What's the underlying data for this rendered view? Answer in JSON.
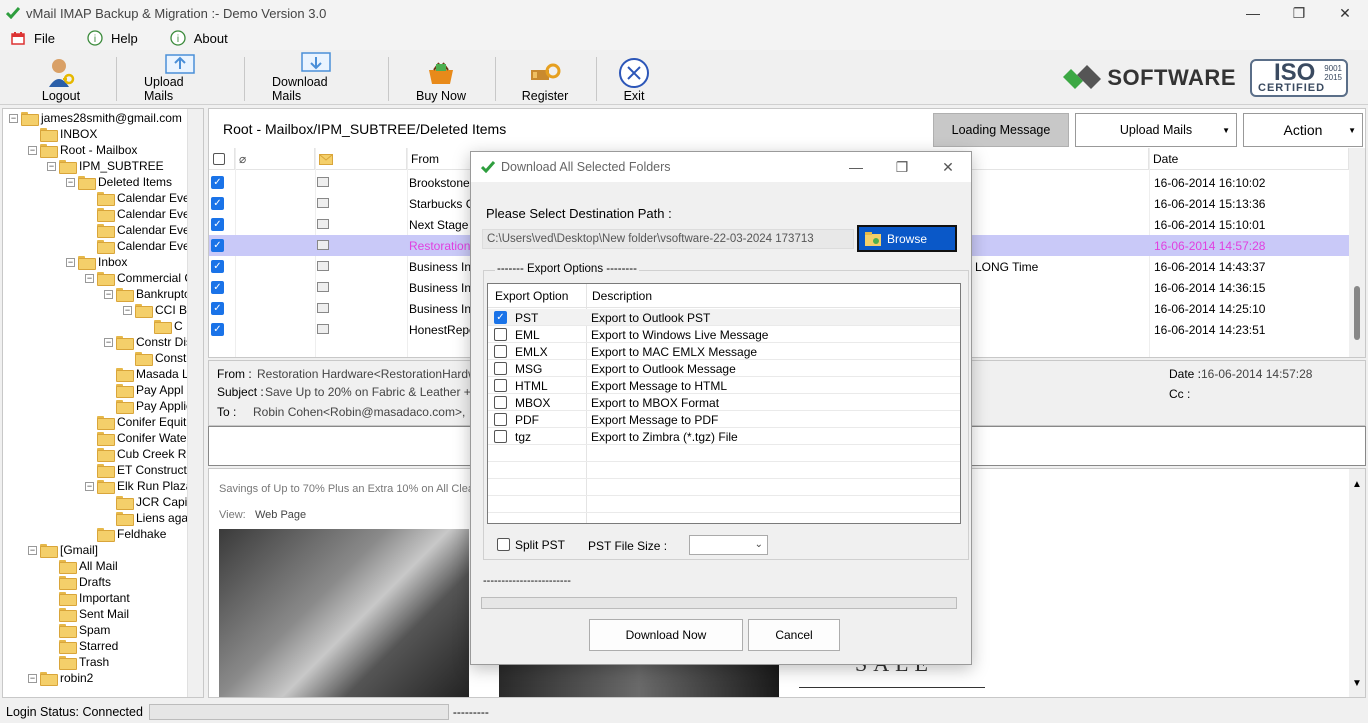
{
  "window": {
    "title": "vMail IMAP Backup & Migration :- Demo Version 3.0",
    "controls": {
      "minimize": "—",
      "maximize": "❐",
      "close": "✕"
    }
  },
  "menu": [
    {
      "label": "File",
      "icon": "file-menu-icon"
    },
    {
      "label": "Help",
      "icon": "help-icon"
    },
    {
      "label": "About",
      "icon": "info-icon"
    }
  ],
  "toolbar": {
    "logout": "Logout",
    "upload": "Upload Mails",
    "download": "Download Mails",
    "buy": "Buy Now",
    "register": "Register",
    "exit": "Exit"
  },
  "brand": {
    "name": "SOFTWARE",
    "iso": "ISO",
    "iso_numbers": "9001\n2015",
    "iso_certified": "CERTIFIED"
  },
  "tree": [
    {
      "label": "james28smith@gmail.com",
      "level": 0,
      "exp": "−"
    },
    {
      "label": "INBOX",
      "level": 1
    },
    {
      "label": "Root - Mailbox",
      "level": 1,
      "exp": "−"
    },
    {
      "label": "IPM_SUBTREE",
      "level": 2,
      "exp": "−"
    },
    {
      "label": "Deleted Items",
      "level": 3,
      "exp": "−"
    },
    {
      "label": "Calendar Ever",
      "level": 4
    },
    {
      "label": "Calendar Ever",
      "level": 4
    },
    {
      "label": "Calendar Ever",
      "level": 4
    },
    {
      "label": "Calendar Ever",
      "level": 4
    },
    {
      "label": "Inbox",
      "level": 3,
      "exp": "−"
    },
    {
      "label": "Commercial C",
      "level": 4,
      "exp": "−"
    },
    {
      "label": "Bankrupto",
      "level": 5,
      "exp": "−"
    },
    {
      "label": "CCI B",
      "level": 6,
      "exp": "−"
    },
    {
      "label": "C",
      "level": 7
    },
    {
      "label": "Constr Dis",
      "level": 5,
      "exp": "−"
    },
    {
      "label": "Const",
      "level": 6
    },
    {
      "label": "Masada L",
      "level": 5
    },
    {
      "label": "Pay Appl",
      "level": 5
    },
    {
      "label": "Pay Applic",
      "level": 5
    },
    {
      "label": "Conifer Equitie",
      "level": 4
    },
    {
      "label": "Conifer Water",
      "level": 4
    },
    {
      "label": "Cub Creek Ra",
      "level": 4
    },
    {
      "label": "ET Constructio",
      "level": 4
    },
    {
      "label": "Elk Run Plaza",
      "level": 4,
      "exp": "−"
    },
    {
      "label": "JCR Capit",
      "level": 5
    },
    {
      "label": "Liens aga",
      "level": 5
    },
    {
      "label": "Feldhake",
      "level": 4
    },
    {
      "label": "[Gmail]",
      "level": 1,
      "exp": "−"
    },
    {
      "label": "All Mail",
      "level": 2
    },
    {
      "label": "Drafts",
      "level": 2
    },
    {
      "label": "Important",
      "level": 2
    },
    {
      "label": "Sent Mail",
      "level": 2
    },
    {
      "label": "Spam",
      "level": 2
    },
    {
      "label": "Starred",
      "level": 2
    },
    {
      "label": "Trash",
      "level": 2
    },
    {
      "label": "robin2",
      "level": 1,
      "exp": "−"
    }
  ],
  "main": {
    "path": "Root - Mailbox/IPM_SUBTREE/Deleted Items",
    "loading": "Loading Message",
    "upload_dd": "Upload Mails",
    "action_dd": "Action"
  },
  "grid": {
    "headers": {
      "from": "From",
      "date": "Date"
    },
    "rows": [
      {
        "from": "Brookstone<b",
        "subject": "",
        "date": "16-06-2014 16:10:02",
        "selected": false
      },
      {
        "from": "Starbucks Co",
        "subject": "",
        "date": "16-06-2014 15:13:36",
        "selected": false
      },
      {
        "from": "Next Stage P",
        "subject": "",
        "date": "16-06-2014 15:10:01",
        "selected": false
      },
      {
        "from": "Restoration",
        "subject": "",
        "date": "16-06-2014 14:57:28",
        "selected": true
      },
      {
        "from": "Business Insi",
        "subject": "LONG Time",
        "date": "16-06-2014 14:43:37",
        "selected": false
      },
      {
        "from": "Business Insi",
        "subject": "",
        "date": "16-06-2014 14:36:15",
        "selected": false
      },
      {
        "from": "Business Insi",
        "subject": "",
        "date": "16-06-2014 14:25:10",
        "selected": false
      },
      {
        "from": "HonestRepor",
        "subject": "",
        "date": "16-06-2014 14:23:51",
        "selected": false
      }
    ]
  },
  "preview": {
    "from_label": "From :",
    "from_value": "Restoration Hardware<RestorationHardware@",
    "subject_label": "Subject :",
    "subject_value": "Save Up to 20% on Fabric & Leather + Extra",
    "to_label": "To :",
    "to_value": "Robin Cohen<Robin@masadaco.com>,",
    "date_label": "Date :",
    "date_value": "16-06-2014 14:57:28",
    "cc_label": "Cc :",
    "body_line1": "Savings of Up to 70% Plus an Extra 10% on All Cleara",
    "body_view": "View:",
    "body_webpage": "Web Page",
    "body_sale": "SALE"
  },
  "status": {
    "label": "Login Status: Connected",
    "dashes": "---------"
  },
  "dialog": {
    "title": "Download All Selected Folders",
    "dest_label": "Please Select Destination Path :",
    "path": "C:\\Users\\ved\\Desktop\\New folder\\vsoftware-22-03-2024 173713",
    "browse": "Browse",
    "group_label": "------- Export Options --------",
    "col_option": "Export Option",
    "col_desc": "Description",
    "options": [
      {
        "name": "PST",
        "desc": "Export to Outlook PST",
        "checked": true
      },
      {
        "name": "EML",
        "desc": "Export to Windows Live Message",
        "checked": false
      },
      {
        "name": "EMLX",
        "desc": "Export to MAC EMLX Message",
        "checked": false
      },
      {
        "name": "MSG",
        "desc": "Export to Outlook Message",
        "checked": false
      },
      {
        "name": "HTML",
        "desc": "Export Message to HTML",
        "checked": false
      },
      {
        "name": "MBOX",
        "desc": "Export to MBOX Format",
        "checked": false
      },
      {
        "name": "PDF",
        "desc": "Export Message to PDF",
        "checked": false
      },
      {
        "name": "tgz",
        "desc": "Export to Zimbra (*.tgz) File",
        "checked": false
      }
    ],
    "split_label": "Split PST",
    "size_label": "PST File Size :",
    "dashes": "------------------------",
    "download_btn": "Download Now",
    "cancel_btn": "Cancel"
  }
}
